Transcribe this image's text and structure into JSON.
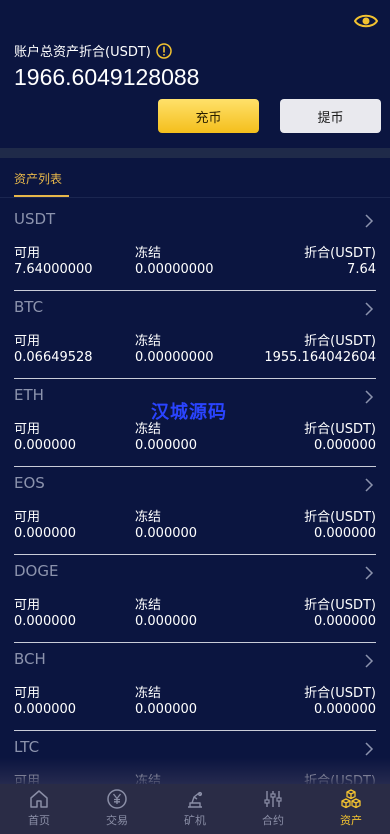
{
  "header": {
    "total_label": "账户总资产折合(USDT)",
    "total_value": "1966.6049128088",
    "deposit_label": "充币",
    "withdraw_label": "提币"
  },
  "tabs": {
    "asset_list": "资产列表"
  },
  "columns": {
    "available": "可用",
    "frozen": "冻结",
    "equivalent": "折合(USDT)"
  },
  "assets": [
    {
      "name": "USDT",
      "available": "7.64000000",
      "frozen": "0.00000000",
      "equivalent": "7.64"
    },
    {
      "name": "BTC",
      "available": "0.06649528",
      "frozen": "0.00000000",
      "equivalent": "1955.164042604"
    },
    {
      "name": "ETH",
      "available": "0.000000",
      "frozen": "0.000000",
      "equivalent": "0.000000"
    },
    {
      "name": "EOS",
      "available": "0.000000",
      "frozen": "0.000000",
      "equivalent": "0.000000"
    },
    {
      "name": "DOGE",
      "available": "0.000000",
      "frozen": "0.000000",
      "equivalent": "0.000000"
    },
    {
      "name": "BCH",
      "available": "0.000000",
      "frozen": "0.000000",
      "equivalent": "0.000000"
    },
    {
      "name": "LTC",
      "available": "",
      "frozen": "",
      "equivalent": ""
    }
  ],
  "watermark": "汉城源码",
  "tabbar": {
    "home": "首页",
    "trade": "交易",
    "mining": "矿机",
    "contract": "合约",
    "assets": "资产"
  },
  "colors": {
    "background": "#0b1540",
    "accent_gold": "#f2c230",
    "tabbar_bg": "#2a2c46"
  },
  "icons": {
    "eye": "eye-icon",
    "info": "info-icon",
    "chevron": "chevron-right-icon",
    "home": "home-icon",
    "trade": "yen-coin-icon",
    "mining": "mining-machine-icon",
    "contract": "sliders-icon",
    "assets": "cubes-icon"
  }
}
